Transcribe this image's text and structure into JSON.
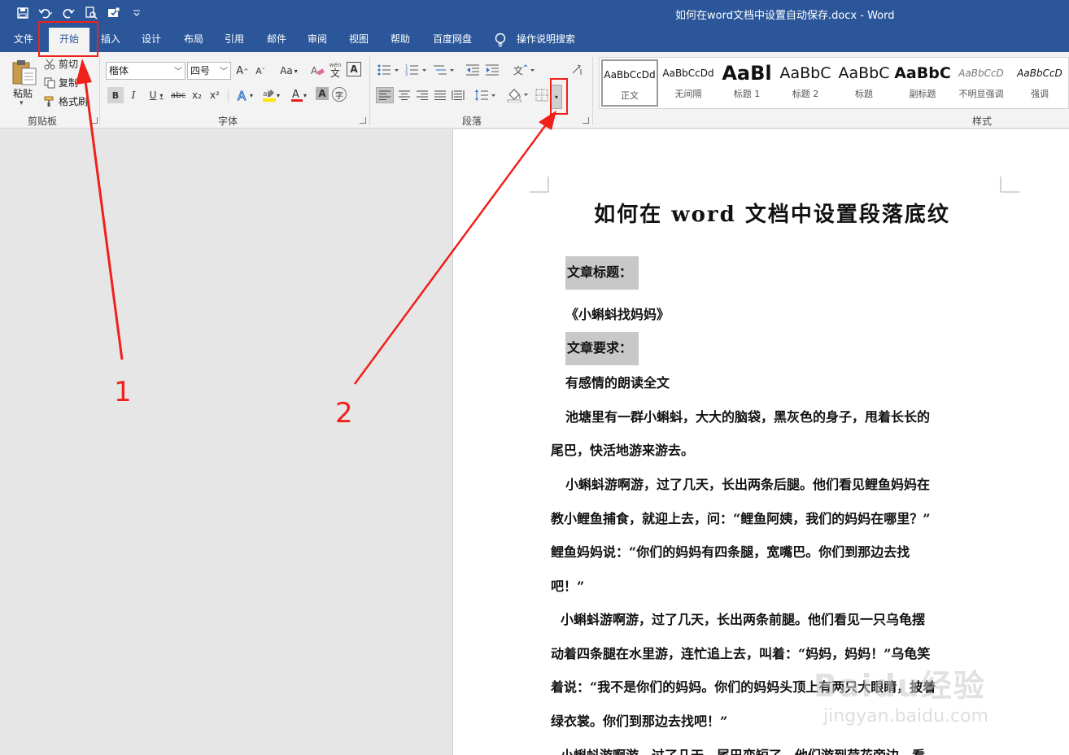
{
  "window": {
    "title": "如何在word文档中设置自动保存.docx  -  Word"
  },
  "tabs": [
    {
      "label": "文件"
    },
    {
      "label": "开始"
    },
    {
      "label": "插入"
    },
    {
      "label": "设计"
    },
    {
      "label": "布局"
    },
    {
      "label": "引用"
    },
    {
      "label": "邮件"
    },
    {
      "label": "审阅"
    },
    {
      "label": "视图"
    },
    {
      "label": "帮助"
    },
    {
      "label": "百度网盘"
    },
    {
      "label": "操作说明搜索"
    }
  ],
  "active_tab": "开始",
  "clipboard": {
    "paste": "粘贴",
    "cut": "剪切",
    "copy": "复制",
    "format_painter": "格式刷",
    "group": "剪贴板"
  },
  "font": {
    "name": "楷体",
    "size": "四号",
    "group": "字体",
    "bold": "B",
    "italic": "I",
    "underline": "U",
    "strike": "abc",
    "sub": "x₂",
    "sup": "x²",
    "clear_label": "A",
    "case_label": "Aa",
    "grow": "A",
    "shrink": "A",
    "phonetic": "wén",
    "border_char": "A",
    "enclose": "字"
  },
  "paragraph": {
    "group": "段落"
  },
  "styles": {
    "group": "样式",
    "items": [
      {
        "preview": "AaBbCcDd",
        "name": "正文"
      },
      {
        "preview": "AaBbCcDd",
        "name": "无间隔"
      },
      {
        "preview": "AaBl",
        "name": "标题 1"
      },
      {
        "preview": "AaBbC",
        "name": "标题 2"
      },
      {
        "preview": "AaBbC",
        "name": "标题"
      },
      {
        "preview": "AaBbC",
        "name": "副标题"
      },
      {
        "preview": "AaBbCcD",
        "name": "不明显强调"
      },
      {
        "preview": "AaBbCcD",
        "name": "强调"
      }
    ]
  },
  "document": {
    "title": "如何在 word 文档中设置段落底纹",
    "lines": [
      "文章标题：",
      "《小蝌蚪找妈妈》",
      "文章要求：",
      "有感情的朗读全文",
      "池塘里有一群小蝌蚪，大大的脑袋，黑灰色的身子，甩着长长的",
      "尾巴，快活地游来游去。",
      "小蝌蚪游啊游，过了几天，长出两条后腿。他们看见鲤鱼妈妈在",
      "教小鲤鱼捕食，就迎上去，问：“鲤鱼阿姨，我们的妈妈在哪里？”",
      "鲤鱼妈妈说：“你们的妈妈有四条腿，宽嘴巴。你们到那边去找",
      "吧！”",
      "小蝌蚪游啊游，过了几天，长出两条前腿。他们看见一只乌龟摆",
      "动着四条腿在水里游，连忙追上去，叫着：“妈妈，妈妈！”乌龟笑",
      "着说：“我不是你们的妈妈。你们的妈妈头顶上有两只大眼睛，披着",
      "绿衣裳。你们到那边去找吧！”",
      "小蝌蚪游啊游，过了几天，尾巴变短了。他们游到荷花旁边，看"
    ]
  },
  "annotations": {
    "label_1": "1",
    "label_2": "2",
    "color": "#f0201a"
  },
  "watermark": {
    "main": "Baidu经验",
    "sub": "jingyan.baidu.com"
  },
  "colors": {
    "titlebar": "#2b579a",
    "ribbon": "#f3f3f3",
    "highlight_yellow": "#ffe600",
    "font_red": "#e02020",
    "shading": "#c8c8c8"
  }
}
